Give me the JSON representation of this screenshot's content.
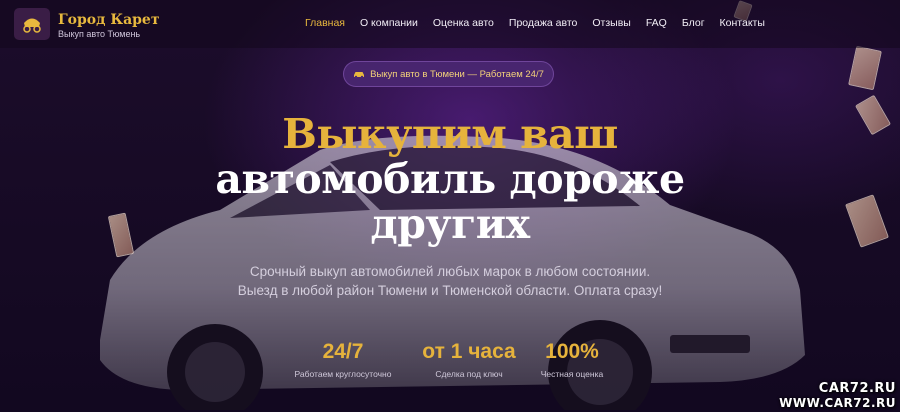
{
  "brand": {
    "title": "Город Карет",
    "subtitle": "Выкуп авто Тюмень"
  },
  "nav": [
    {
      "label": "Главная",
      "active": true
    },
    {
      "label": "О компании"
    },
    {
      "label": "Оценка авто"
    },
    {
      "label": "Продажа авто"
    },
    {
      "label": "Отзывы"
    },
    {
      "label": "FAQ"
    },
    {
      "label": "Блог"
    },
    {
      "label": "Контакты"
    }
  ],
  "pill": {
    "icon": "car-icon",
    "text": "Выкуп авто в Тюмени — Работаем 24/7"
  },
  "headline": {
    "line1": "Выкупим ваш",
    "line2": "автомобиль дороже",
    "line3": "других"
  },
  "subtitle": {
    "line1": "Срочный выкуп автомобилей любых марок в любом состоянии.",
    "line2": "Выезд в любой район Тюмени и Тюменской области. Оплата сразу!"
  },
  "stats": [
    {
      "value": "24/7",
      "label": "Работаем круглосуточно"
    },
    {
      "value": "от 1 часа",
      "label": "Сделка под ключ"
    },
    {
      "value": "100%",
      "label": "Честная оценка"
    }
  ],
  "watermark": {
    "line1": "CAR72.RU",
    "line2": "WWW.CAR72.RU"
  },
  "colors": {
    "accent": "#e6b33c",
    "background": "#14091f",
    "pill": "#4b2873"
  }
}
